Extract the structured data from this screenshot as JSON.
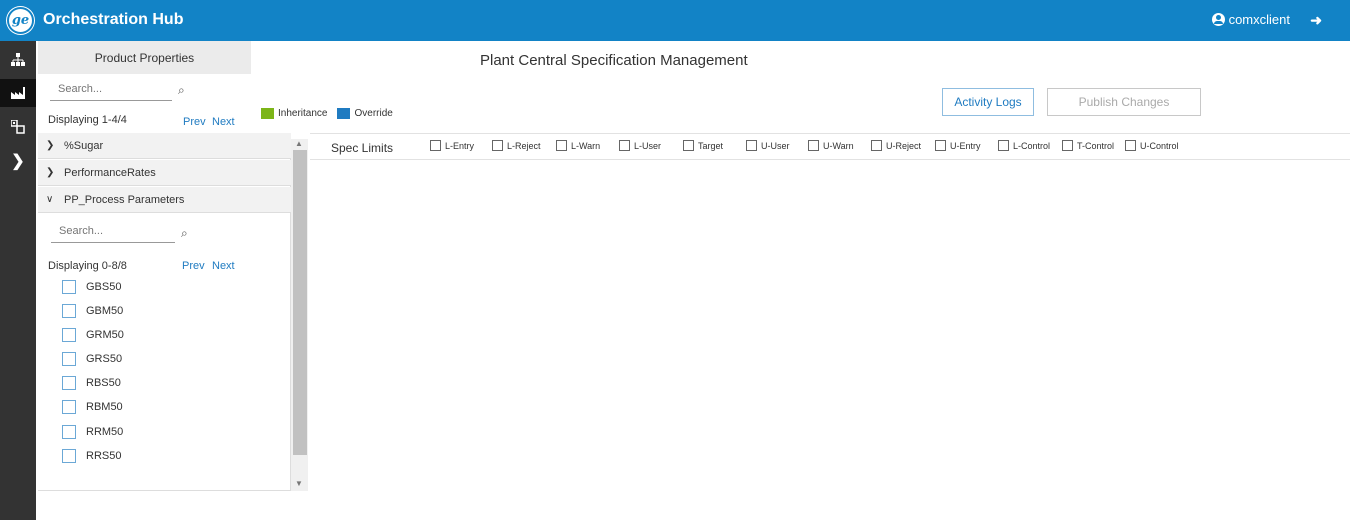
{
  "header": {
    "logo_text": "ge",
    "app_title": "Orchestration Hub",
    "user_name": "comxclient",
    "logout_icon": "logout-icon"
  },
  "rail": {
    "items": [
      {
        "icon": "hierarchy-icon",
        "glyph": "∴"
      },
      {
        "icon": "factory-icon",
        "glyph": "▁▃▅"
      },
      {
        "icon": "modules-icon",
        "glyph": "⧉"
      },
      {
        "icon": "chevron-right-icon",
        "glyph": "❯"
      }
    ]
  },
  "left_panel": {
    "tab_label": "Product Properties",
    "search_placeholder": "Search...",
    "displaying": "Displaying 1-4/4",
    "prev": "Prev",
    "next": "Next",
    "nodes": [
      {
        "label": "%Sugar",
        "expanded": false
      },
      {
        "label": "PerformanceRates",
        "expanded": false
      },
      {
        "label": "PP_Process Parameters",
        "expanded": true
      }
    ],
    "sub": {
      "search_placeholder": "Search...",
      "displaying": "Displaying 0-8/8",
      "prev": "Prev",
      "next": "Next",
      "items": [
        "GBS50",
        "GBM50",
        "GRM50",
        "GRS50",
        "RBS50",
        "RBM50",
        "RRM50",
        "RRS50"
      ]
    }
  },
  "legend": {
    "inheritance": "Inheritance",
    "override": "Override",
    "inheritance_color": "#7cb518",
    "override_color": "#1f7bc1"
  },
  "main": {
    "title": "Plant Central Specification Management",
    "activity_logs": "Activity Logs",
    "publish_changes": "Publish Changes",
    "spec_limits_label": "Spec Limits",
    "spec_limits": [
      "L-Entry",
      "L-Reject",
      "L-Warn",
      "L-User",
      "Target",
      "U-User",
      "U-Warn",
      "U-Reject",
      "U-Entry",
      "L-Control",
      "T-Control",
      "U-Control"
    ]
  }
}
